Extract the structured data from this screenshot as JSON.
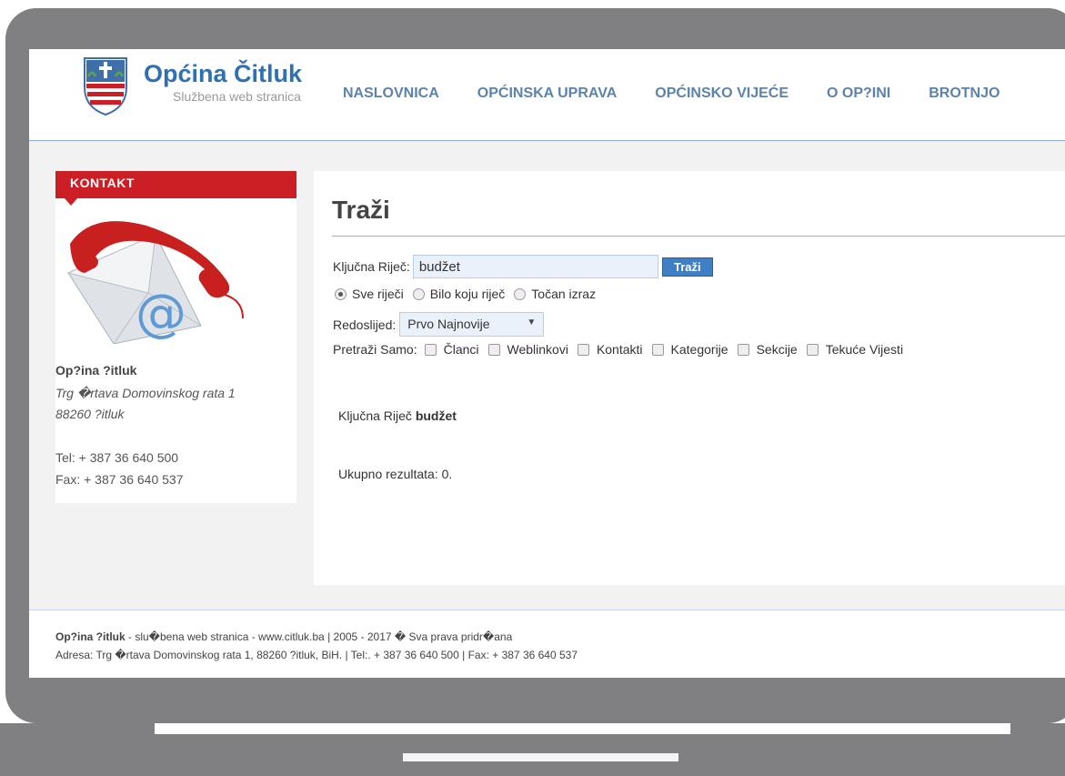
{
  "header": {
    "logo_title": "Općina Čitluk",
    "logo_subtitle": "Službena web stranica",
    "nav": [
      "NASLOVNICA",
      "OPĆINSKA UPRAVA",
      "OPĆINSKO VIJEĆE",
      "O OP?INI",
      "BROTNJO"
    ]
  },
  "sidebar": {
    "heading": "KONTAKT",
    "name": "Op?ina ?itluk",
    "address_line1": "Trg �rtava Domovinskog rata 1",
    "address_line2": "88260 ?itluk",
    "tel": "Tel: + 387 36 640 500",
    "fax": "Fax: + 387 36 640 537"
  },
  "search": {
    "title": "Traži",
    "keyword_label": "Ključna Riječ:",
    "keyword_value": "budžet",
    "button_label": "Traži",
    "radio_options": [
      {
        "label": "Sve riječi",
        "checked": true
      },
      {
        "label": "Bilo koju riječ",
        "checked": false
      },
      {
        "label": "Točan izraz",
        "checked": false
      }
    ],
    "order_label": "Redoslijed:",
    "order_value": "Prvo Najnovije",
    "filter_label": "Pretraži Samo:",
    "filters": [
      "Članci",
      "Weblinkovi",
      "Kontakti",
      "Kategorije",
      "Sekcije",
      "Tekuće Vijesti"
    ]
  },
  "results": {
    "keyword_prefix": "Ključna Riječ",
    "keyword": "budžet",
    "total": "Ukupno rezultata: 0."
  },
  "footer": {
    "line1_bold": "Op?ina ?itluk",
    "line1_rest": " - slu�bena web stranica - www.citluk.ba | 2005 - 2017 � Sva prava pridr�ana",
    "line2": "Adresa: Trg �rtava Domovinskog rata 1, 88260 ?itluk, BiH. | Tel:. + 387 36 640 500 | Fax: + 387 36 640 537"
  },
  "colors": {
    "brand_blue": "#2f6fb2",
    "nav_blue": "#5d83aa",
    "accent_red": "#cc1f25",
    "frame_gray": "#808083"
  }
}
